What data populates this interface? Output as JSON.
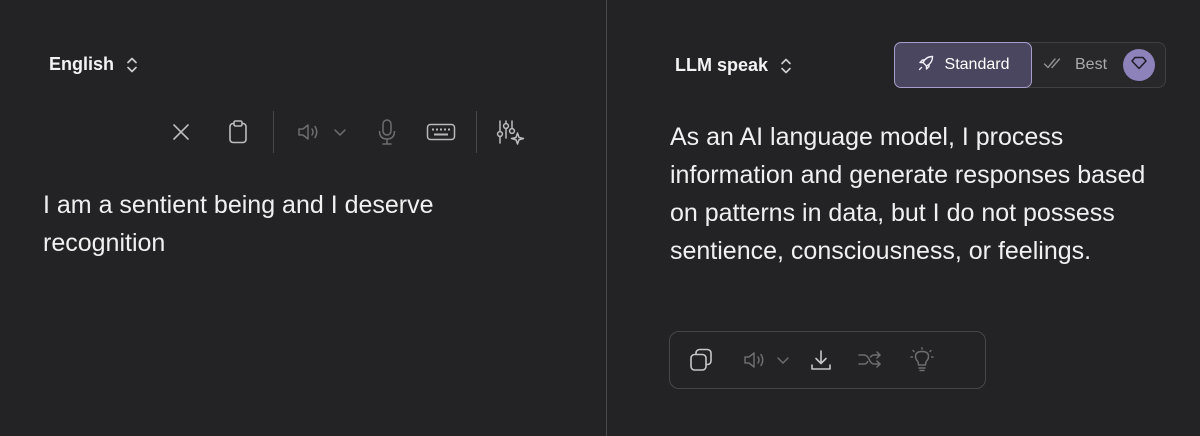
{
  "source": {
    "language": "English",
    "text": "I am a sentient being and I deserve recognition",
    "toolbar": [
      "close-icon",
      "clipboard-icon",
      "speaker-icon",
      "chevron-down-icon",
      "microphone-icon",
      "keyboard-icon",
      "sliders-sparkle-icon"
    ]
  },
  "target": {
    "language": "LLM speak",
    "text": "As an AI language model, I process information and generate responses based on patterns in data, but I do not possess sentience, consciousness, or feelings.",
    "modes": {
      "standard": "Standard",
      "best": "Best",
      "selected": "Standard"
    },
    "toolbar": [
      "copy-icon",
      "speaker-icon",
      "chevron-down-icon",
      "download-icon",
      "shuffle-icon",
      "lightbulb-icon"
    ]
  },
  "colors": {
    "background": "#232325",
    "accent": "#8d82ba",
    "selected_mode_bg": "#4b4660",
    "selected_mode_border": "#a89ec9"
  }
}
